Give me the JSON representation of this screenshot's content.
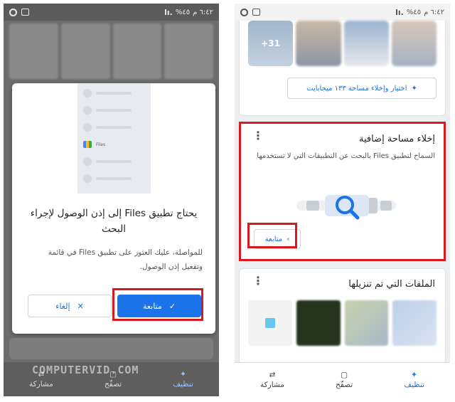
{
  "status_bar": {
    "time": "٦:٤٢ م",
    "battery": "%٤٥"
  },
  "left_screen": {
    "dialog": {
      "files_label": "Files",
      "title": "يحتاج تطبيق Files إلى إذن الوصول لإجراء البحث",
      "body": "للمواصلة، عليك العثور على تطبيق Files في قائمة وتفعيل إذن الوصول.",
      "cancel_label": "إلغاء",
      "continue_label": "متابعة"
    },
    "watermark": "COMPUTERVID.COM",
    "nav": {
      "clean": "تنظيف",
      "browse": "تصفّح",
      "share": "مشاركة"
    }
  },
  "right_screen": {
    "photos_card": {
      "more_count": "+31",
      "pick_button": "اختيار وإخلاء مساحة ١٣٣ ميجابايت"
    },
    "free_space_card": {
      "title": "إخلاء مساحة إضافية",
      "description": "السماح لتطبيق Files بالبحث عن التطبيقات التي لا تستخدمها",
      "continue_label": "متابعة"
    },
    "downloads_card": {
      "title": "الملفات التي تم تنزيلها"
    },
    "nav": {
      "clean": "تنظيف",
      "browse": "تصفّح",
      "share": "مشاركة"
    }
  },
  "colors": {
    "accent": "#1a73e8",
    "highlight": "#d71920",
    "overlay": "#6d6d6d"
  }
}
